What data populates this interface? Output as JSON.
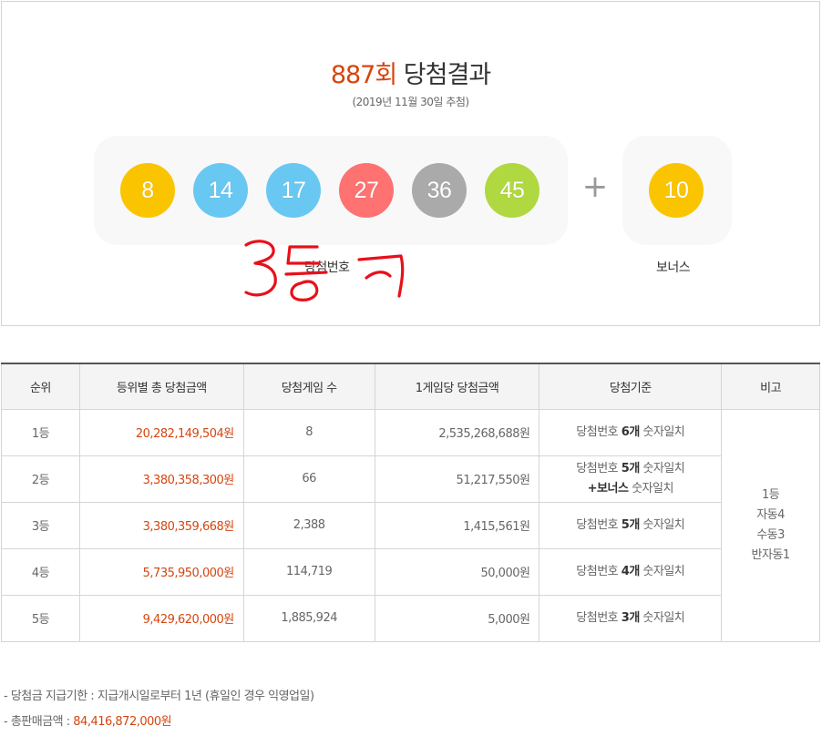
{
  "header": {
    "round": "887회",
    "title": "당첨결과",
    "date": "(2019년 11월 30일 추첨)"
  },
  "winning": {
    "numbers": [
      {
        "value": "8",
        "color": "#fbc400"
      },
      {
        "value": "14",
        "color": "#69c8f2"
      },
      {
        "value": "17",
        "color": "#69c8f2"
      },
      {
        "value": "27",
        "color": "#ff7272"
      },
      {
        "value": "36",
        "color": "#aaaaaa"
      },
      {
        "value": "45",
        "color": "#b0d840"
      }
    ],
    "plus": "+",
    "bonus": {
      "value": "10",
      "color": "#fbc400"
    },
    "label": "당첨번호",
    "bonus_label": "보너스"
  },
  "table": {
    "headers": [
      "순위",
      "등위별 총 당첨금액",
      "당첨게임 수",
      "1게임당 당첨금액",
      "당첨기준",
      "비고"
    ],
    "rows": [
      {
        "rank": "1등",
        "total": "20,282,149,504원",
        "count": "8",
        "per": "2,535,268,688원",
        "crit_pre": "당첨번호 ",
        "crit_bold": "6개",
        "crit_post": " 숫자일치"
      },
      {
        "rank": "2등",
        "total": "3,380,358,300원",
        "count": "66",
        "per": "51,217,550원",
        "crit_pre": "당첨번호 ",
        "crit_bold": "5개",
        "crit_post": " 숫자일치",
        "crit_line2_bold": "+보너스",
        "crit_line2_post": " 숫자일치"
      },
      {
        "rank": "3등",
        "total": "3,380,359,668원",
        "count": "2,388",
        "per": "1,415,561원",
        "crit_pre": "당첨번호 ",
        "crit_bold": "5개",
        "crit_post": " 숫자일치"
      },
      {
        "rank": "4등",
        "total": "5,735,950,000원",
        "count": "114,719",
        "per": "50,000원",
        "crit_pre": "당첨번호 ",
        "crit_bold": "4개",
        "crit_post": " 숫자일치"
      },
      {
        "rank": "5등",
        "total": "9,429,620,000원",
        "count": "1,885,924",
        "per": "5,000원",
        "crit_pre": "당첨번호 ",
        "crit_bold": "3개",
        "crit_post": " 숫자일치"
      }
    ],
    "remarks": [
      "1등",
      "자동4",
      "수동3",
      "반자동1"
    ]
  },
  "notes": {
    "deadline_label": "-  당첨금 지급기한 : ",
    "deadline_value": "지급개시일로부터 1년 (휴일인 경우 익영업일)",
    "sales_label": "-  총판매금액 : ",
    "sales_value": "84,416,872,000원"
  },
  "annotation": {
    "color": "#e8101a"
  }
}
